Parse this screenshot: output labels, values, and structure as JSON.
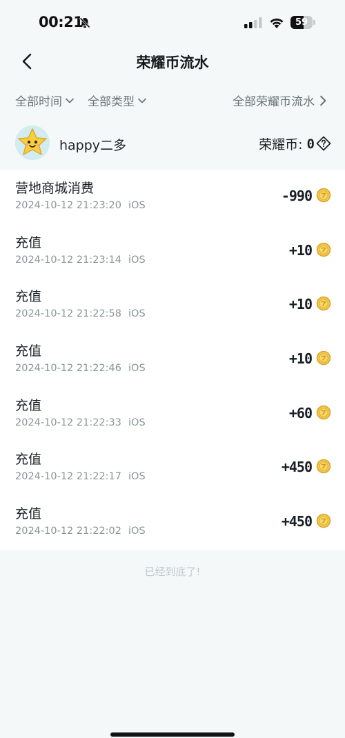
{
  "status_bar": {
    "time": "00:21",
    "battery_level": "59",
    "battery_fraction": 0.59
  },
  "nav": {
    "title": "荣耀币流水"
  },
  "filters": {
    "time": "全部时间",
    "type": "全部类型",
    "all_flow": "全部荣耀币流水"
  },
  "user": {
    "name": "happy二多",
    "balance_label": "荣耀币:",
    "balance_value": "0"
  },
  "transactions": [
    {
      "title": "营地商城消费",
      "datetime": "2024-10-12 21:23:20",
      "platform": "iOS",
      "amount": "-990"
    },
    {
      "title": "充值",
      "datetime": "2024-10-12 21:23:14",
      "platform": "iOS",
      "amount": "+10"
    },
    {
      "title": "充值",
      "datetime": "2024-10-12 21:22:58",
      "platform": "iOS",
      "amount": "+10"
    },
    {
      "title": "充值",
      "datetime": "2024-10-12 21:22:46",
      "platform": "iOS",
      "amount": "+10"
    },
    {
      "title": "充值",
      "datetime": "2024-10-12 21:22:33",
      "platform": "iOS",
      "amount": "+60"
    },
    {
      "title": "充值",
      "datetime": "2024-10-12 21:22:17",
      "platform": "iOS",
      "amount": "+450"
    },
    {
      "title": "充值",
      "datetime": "2024-10-12 21:22:02",
      "platform": "iOS",
      "amount": "+450"
    }
  ],
  "footer": {
    "end_text": "已经到底了!"
  },
  "colors": {
    "background": "#f4f8f8",
    "coin_gold": "#e9b93a",
    "muted_text": "#8a9398"
  },
  "icons": [
    "bell-off-icon",
    "signal-icon",
    "wifi-icon",
    "battery-icon",
    "back-arrow-icon",
    "chevron-down-icon",
    "chevron-right-icon",
    "star-avatar",
    "help-diamond-icon",
    "coin-icon"
  ]
}
